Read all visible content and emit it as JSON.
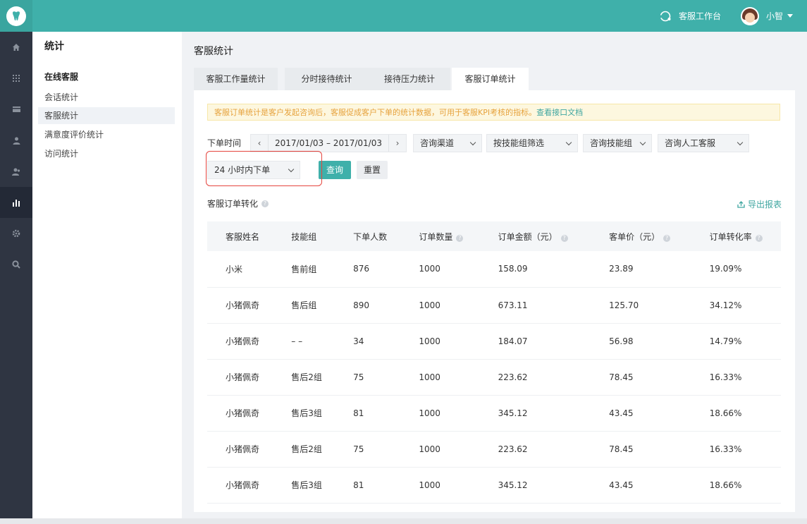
{
  "topbar": {
    "workspace_label": "客服工作台",
    "user_name": "小智",
    "accent": "#3fb0aa"
  },
  "nav_icons": [
    "home-icon",
    "grid-icon",
    "card-icon",
    "person-icon",
    "team-icon",
    "stats-icon",
    "settings-icon",
    "search-icon"
  ],
  "sidebar": {
    "title": "统计",
    "group": "在线客服",
    "items": [
      {
        "label": "会话统计"
      },
      {
        "label": "客服统计"
      },
      {
        "label": "满意度评价统计"
      },
      {
        "label": "访问统计"
      }
    ]
  },
  "main": {
    "title": "客服统计",
    "tabs": [
      {
        "label": "客服工作量统计"
      },
      {
        "label": "分时接待统计"
      },
      {
        "label": "接待压力统计"
      },
      {
        "label": "客服订单统计"
      }
    ],
    "notice": {
      "text": "客服订单统计是客户发起咨询后，客服促成客户下单的统计数据，可用于客服KPI考核的指标。",
      "link": "查看接口文档"
    },
    "filters": {
      "time_label": "下单时间",
      "date_range": "2017/01/03 – 2017/01/03",
      "channel": "咨询渠道",
      "skill_filter": "按技能组筛选",
      "skill_group": "咨询技能组",
      "agent": "咨询人工客服",
      "order_window": "24 小时内下单",
      "query_button": "查询",
      "reset_button": "重置"
    },
    "section": {
      "title": "客服订单转化",
      "export": "导出报表"
    },
    "table": {
      "headers": [
        "客服姓名",
        "技能组",
        "下单人数",
        "订单数量",
        "订单金额（元）",
        "客单价（元）",
        "订单转化率"
      ],
      "rows": [
        [
          "小米",
          "售前组",
          "876",
          "1000",
          "158.09",
          "23.89",
          "19.09%"
        ],
        [
          "小猪佩奇",
          "售后组",
          "890",
          "1000",
          "673.11",
          "125.70",
          "34.12%"
        ],
        [
          "小猪佩奇",
          "– –",
          "34",
          "1000",
          "184.07",
          "56.98",
          "14.79%"
        ],
        [
          "小猪佩奇",
          "售后2组",
          "75",
          "1000",
          "223.62",
          "78.45",
          "16.33%"
        ],
        [
          "小猪佩奇",
          "售后3组",
          "81",
          "1000",
          "345.12",
          "43.45",
          "18.66%"
        ],
        [
          "小猪佩奇",
          "售后2组",
          "75",
          "1000",
          "223.62",
          "78.45",
          "16.33%"
        ],
        [
          "小猪佩奇",
          "售后3组",
          "81",
          "1000",
          "345.12",
          "43.45",
          "18.66%"
        ]
      ]
    }
  }
}
